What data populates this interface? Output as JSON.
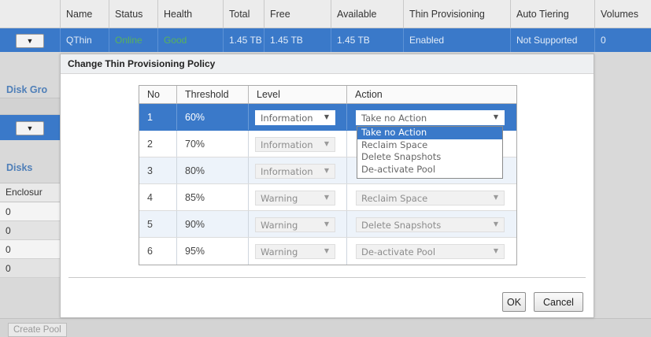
{
  "pool_table": {
    "columns": [
      "Name",
      "Status",
      "Health",
      "Total",
      "Free",
      "Available",
      "Thin Provisioning",
      "Auto Tiering",
      "Volumes"
    ],
    "row": {
      "name": "QThin",
      "status": "Online",
      "health": "Good",
      "total": "1.45 TB",
      "free": "1.45 TB",
      "available": "1.45 TB",
      "thin_provisioning": "Enabled",
      "auto_tiering": "Not Supported",
      "volumes": "0"
    },
    "expand_glyph": "▼"
  },
  "background": {
    "disk_groups_label": "Disk Gro",
    "disks_label": "Disks",
    "enclosure_header": "Enclosur",
    "enclosure_values": [
      "0",
      "0",
      "0",
      "0"
    ],
    "expand_glyph": "▼",
    "create_pool_label": "Create Pool"
  },
  "dialog": {
    "title": "Change Thin Provisioning Policy",
    "headers": {
      "no": "No",
      "threshold": "Threshold",
      "level": "Level",
      "action": "Action"
    },
    "rows": [
      {
        "no": "1",
        "threshold": "60%",
        "level": "Information",
        "action": "Take no Action"
      },
      {
        "no": "2",
        "threshold": "70%",
        "level": "Information",
        "action": ""
      },
      {
        "no": "3",
        "threshold": "80%",
        "level": "Information",
        "action": ""
      },
      {
        "no": "4",
        "threshold": "85%",
        "level": "Warning",
        "action": "Reclaim Space"
      },
      {
        "no": "5",
        "threshold": "90%",
        "level": "Warning",
        "action": "Delete Snapshots"
      },
      {
        "no": "6",
        "threshold": "95%",
        "level": "Warning",
        "action": "De-activate Pool"
      }
    ],
    "arrow_glyph": "▼",
    "action_dropdown_options": [
      "Take no Action",
      "Reclaim Space",
      "Delete Snapshots",
      "De-activate Pool"
    ],
    "ok_label": "OK",
    "cancel_label": "Cancel"
  },
  "colors": {
    "selection_blue": "#3a79c9",
    "status_green": "#58b25a",
    "section_label_blue": "#4f7fb8"
  },
  "icons": {
    "expand": "triangle-down-icon",
    "select_arrow": "triangle-down-icon"
  }
}
